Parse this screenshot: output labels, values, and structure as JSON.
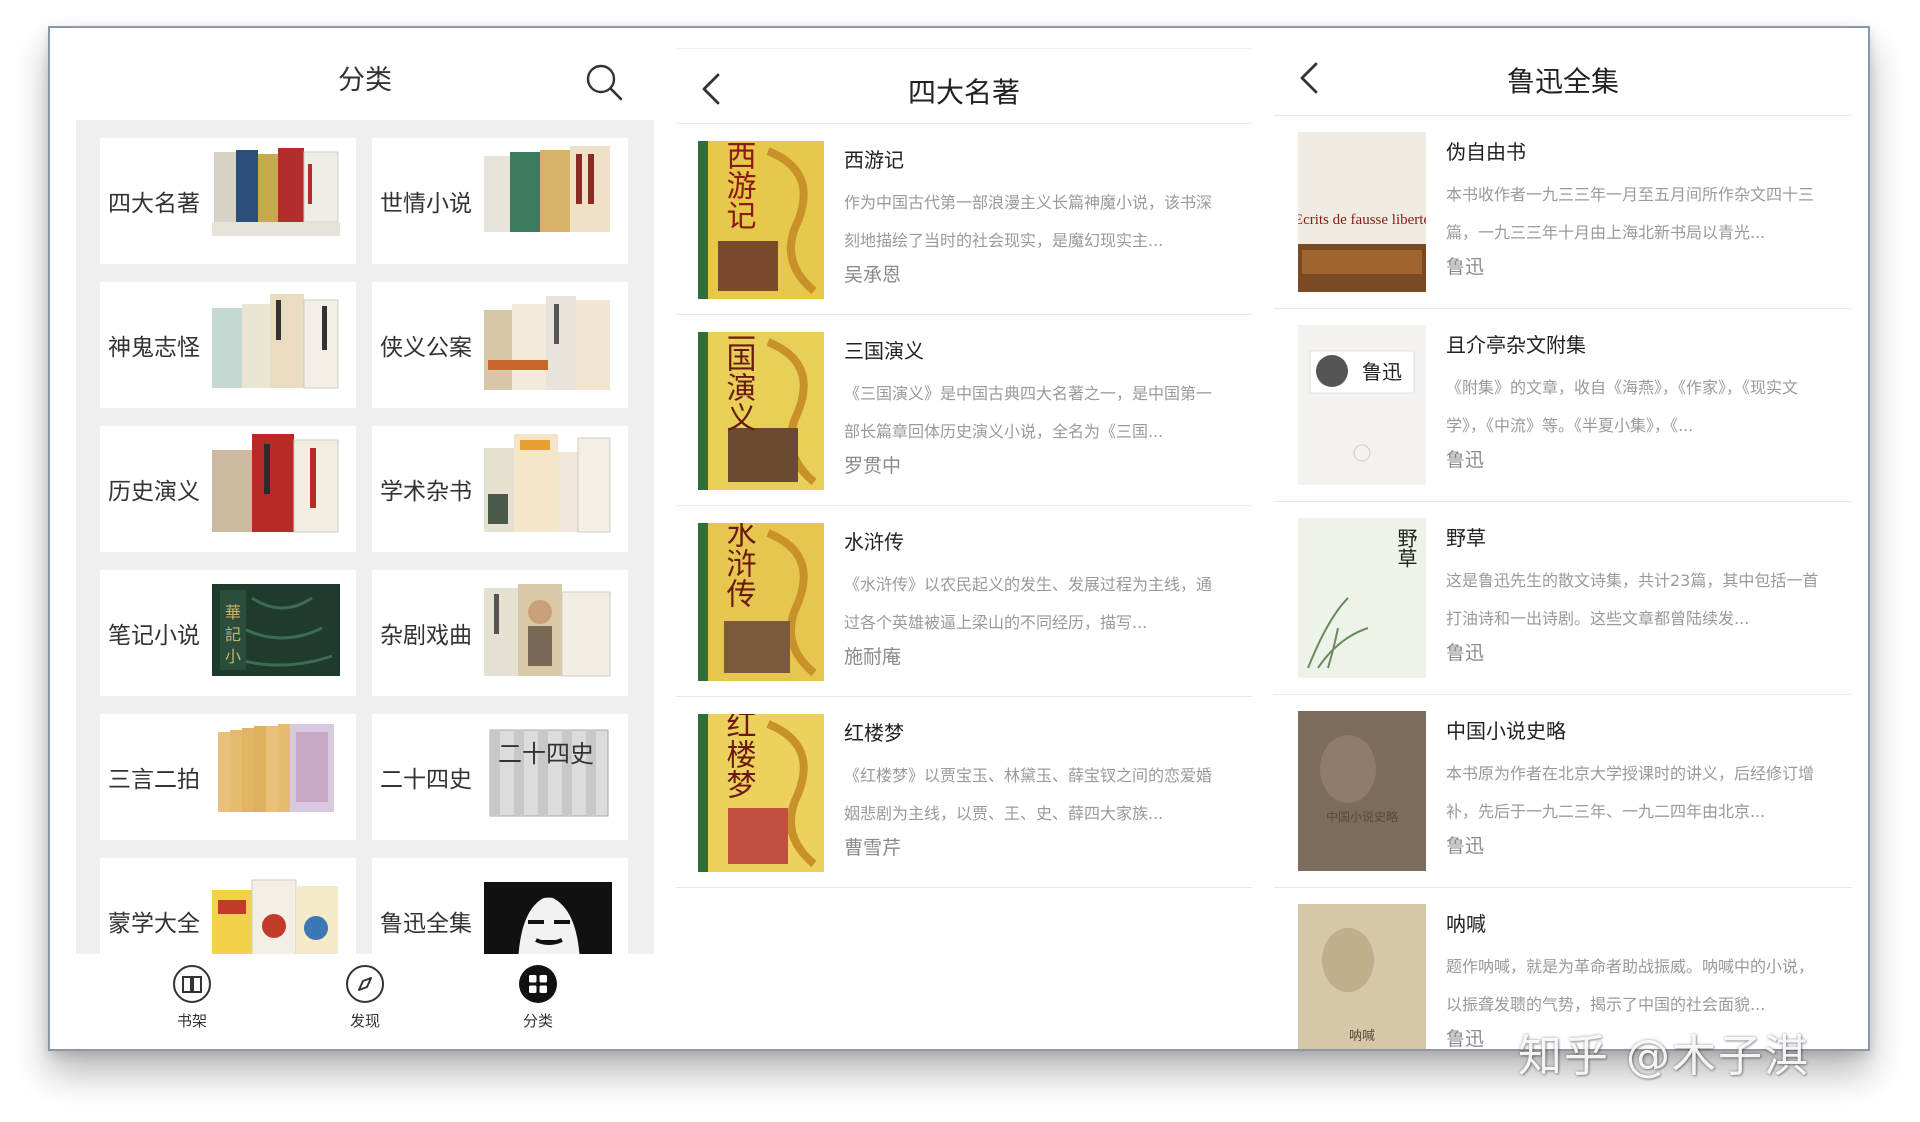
{
  "categories_panel": {
    "title": "分类",
    "search_icon": "search-icon",
    "items": [
      {
        "label": "四大名著"
      },
      {
        "label": "世情小说"
      },
      {
        "label": "神鬼志怪"
      },
      {
        "label": "侠义公案"
      },
      {
        "label": "历史演义"
      },
      {
        "label": "学术杂书"
      },
      {
        "label": "笔记小说"
      },
      {
        "label": "杂剧戏曲"
      },
      {
        "label": "三言二拍"
      },
      {
        "label": "二十四史"
      },
      {
        "label": "蒙学大全"
      },
      {
        "label": "鲁迅全集"
      }
    ],
    "tabs": [
      {
        "label": "书架",
        "icon": "book-icon"
      },
      {
        "label": "发现",
        "icon": "compass-icon"
      },
      {
        "label": "分类",
        "icon": "grid-icon",
        "active": true
      }
    ]
  },
  "classics_panel": {
    "title": "四大名著",
    "books": [
      {
        "title": "西游记",
        "desc": "作为中国古代第一部浪漫主义长篇神魔小说，该书深刻地描绘了当时的社会现实，是魔幻现实主...",
        "author": "吴承恩",
        "cover_text": "西游记"
      },
      {
        "title": "三国演义",
        "desc": "《三国演义》是中国古典四大名著之一，是中国第一部长篇章回体历史演义小说，全名为《三国...",
        "author": "罗贯中",
        "cover_text": "三国演义"
      },
      {
        "title": "水浒传",
        "desc": "《水浒传》以农民起义的发生、发展过程为主线，通过各个英雄被逼上梁山的不同经历，描写...",
        "author": "施耐庵",
        "cover_text": "水浒传"
      },
      {
        "title": "红楼梦",
        "desc": "《红楼梦》以贾宝玉、林黛玉、薛宝钗之间的恋爱婚姻悲剧为主线，以贾、王、史、薛四大家族...",
        "author": "曹雪芹",
        "cover_text": "红楼梦"
      }
    ]
  },
  "luxun_panel": {
    "title": "鲁迅全集",
    "books": [
      {
        "title": "伪自由书",
        "desc": "本书收作者一九三三年一月至五月间所作杂文四十三篇，一九三三年十月由上海北新书局以青光...",
        "author": "鲁迅",
        "cover_text": "Ecrits de fausse liberté"
      },
      {
        "title": "且介亭杂文附集",
        "desc": "《附集》的文章，收自《海燕》，《作家》，《现实文学》，《中流》等。《半夏小集》，《...",
        "author": "鲁迅",
        "cover_text": "鲁迅"
      },
      {
        "title": "野草",
        "desc": "这是鲁迅先生的散文诗集，共计23篇，其中包括一首打油诗和一出诗剧。这些文章都曾陆续发...",
        "author": "鲁迅",
        "cover_text": "野草"
      },
      {
        "title": "中国小说史略",
        "desc": "本书原为作者在北京大学授课时的讲义，后经修订增补，先后于一九二三年、一九二四年由北京...",
        "author": "鲁迅",
        "cover_text": "中国小说史略"
      },
      {
        "title": "呐喊",
        "desc": "题作呐喊，就是为革命者助战振威。呐喊中的小说，以振聋发聩的气势，揭示了中国的社会面貌...",
        "author": "鲁迅",
        "cover_text": "呐喊"
      }
    ]
  },
  "watermark": "知乎 @木子淇"
}
